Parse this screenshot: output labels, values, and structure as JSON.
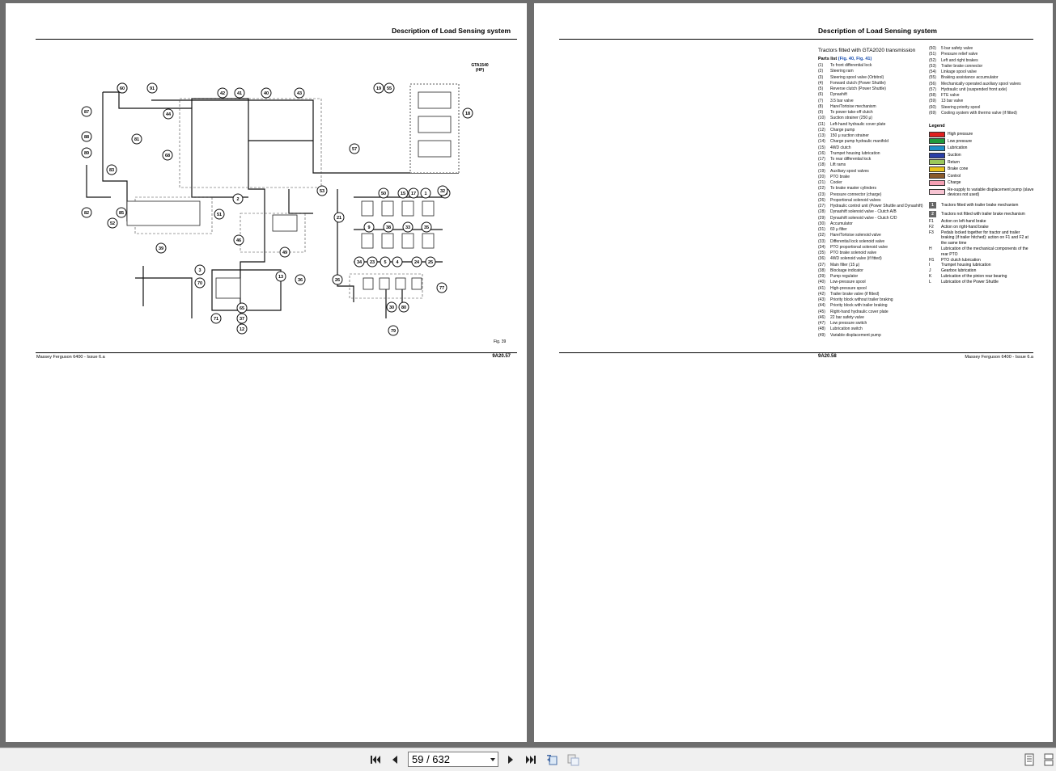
{
  "left_page": {
    "header": "Description of Load Sensing system",
    "footer_left": "Massey Ferguson 6400 - Issue 6.a",
    "footer_right": "9A20.57",
    "diagram_label": "GTA1540\n(HP)",
    "figure": "Fig. 39",
    "callouts": [
      "92",
      "91",
      "42",
      "41",
      "40",
      "43",
      "19",
      "55",
      "18",
      "87",
      "88",
      "89",
      "81",
      "44",
      "68",
      "57",
      "83",
      "52",
      "82",
      "85",
      "2",
      "51",
      "53",
      "21",
      "46",
      "49",
      "39",
      "3",
      "70",
      "71",
      "65",
      "37",
      "12",
      "13",
      "36",
      "50",
      "15",
      "17",
      "1",
      "20",
      "9",
      "38",
      "33",
      "35",
      "34",
      "23",
      "5",
      "4",
      "24",
      "25",
      "26",
      "30",
      "80",
      "77",
      "79",
      "32",
      "60"
    ]
  },
  "right_page": {
    "header": "Description of Load Sensing system",
    "footer_left": "9A20.58",
    "footer_right": "Massey Ferguson 6400 - Issue 6.a",
    "title": "Tractors fitted with GTA2020 transmission",
    "parts_list_label": "Parts list",
    "parts_list_ref": "(Fig. 40, Fig. 41)",
    "parts_col1": [
      [
        "(1)",
        "To front differential lock"
      ],
      [
        "(2)",
        "Steering ram"
      ],
      [
        "(3)",
        "Steering spool valve (Orbitrol)"
      ],
      [
        "(4)",
        "Forward clutch (Power Shuttle)"
      ],
      [
        "(5)",
        "Reverse clutch (Power Shuttle)"
      ],
      [
        "(6)",
        "Dynashift"
      ],
      [
        "(7)",
        "3.5 bar valve"
      ],
      [
        "(8)",
        "Hare/Tortoise mechanism"
      ],
      [
        "(9)",
        "To power take-off clutch"
      ],
      [
        "(10)",
        "Suction strainer (250 μ)"
      ],
      [
        "(11)",
        "Left-hand hydraulic cover plate"
      ],
      [
        "(12)",
        "Charge pump"
      ],
      [
        "(13)",
        "150 μ suction strainer"
      ],
      [
        "(14)",
        "Charge pump hydraulic manifold"
      ],
      [
        "(15)",
        "4WD clutch"
      ],
      [
        "(16)",
        "Trumpet housing lubrication"
      ],
      [
        "(17)",
        "To rear differential lock"
      ],
      [
        "(18)",
        "Lift rams"
      ],
      [
        "(19)",
        "Auxiliary spool valves"
      ],
      [
        "(20)",
        "PTO brake"
      ],
      [
        "(21)",
        "Cooler"
      ],
      [
        "(22)",
        "To brake master cylinders"
      ],
      [
        "(23)",
        "Pressure connector (charge)"
      ],
      [
        "(26)",
        "Proportional solenoid valves"
      ],
      [
        "(27)",
        "Hydraulic control unit (Power Shuttle and Dynashift)"
      ],
      [
        "(28)",
        "Dynashift solenoid valve - Clutch A/B"
      ],
      [
        "(29)",
        "Dynashift solenoid valve - Clutch C/D"
      ],
      [
        "(30)",
        "Accumulator"
      ],
      [
        "(31)",
        "60 μ filter"
      ],
      [
        "(32)",
        "Hare/Tortoise solenoid valve"
      ],
      [
        "(33)",
        "Differential lock solenoid valve"
      ],
      [
        "(34)",
        "PTO proportional solenoid valve"
      ],
      [
        "(35)",
        "PTO brake solenoid valve"
      ],
      [
        "(36)",
        "4WD solenoid valve (if fitted)"
      ],
      [
        "(37)",
        "Main filter (15 μ)"
      ],
      [
        "(38)",
        "Blockage indicator"
      ],
      [
        "(39)",
        "Pump regulator"
      ],
      [
        "(40)",
        "Low-pressure spool"
      ],
      [
        "(41)",
        "High-pressure spool"
      ],
      [
        "(42)",
        "Trailer brake valve (if fitted)"
      ],
      [
        "(43)",
        "Priority block without trailer braking"
      ],
      [
        "(44)",
        "Priority block with trailer braking"
      ],
      [
        "(45)",
        "Right-hand hydraulic cover plate"
      ],
      [
        "(46)",
        "22 bar safety valve"
      ],
      [
        "(47)",
        "Low pressure switch"
      ],
      [
        "(48)",
        "Lubrication switch"
      ],
      [
        "(49)",
        "Variable displacement pump"
      ]
    ],
    "parts_col2": [
      [
        "(50)",
        "5 bar safety valve"
      ],
      [
        "(51)",
        "Pressure relief valve"
      ],
      [
        "(52)",
        "Left and right brakes"
      ],
      [
        "(53)",
        "Trailer brake connector"
      ],
      [
        "(54)",
        "Linkage spool valve"
      ],
      [
        "(55)",
        "Braking assistance accumulator"
      ],
      [
        "(56)",
        "Mechanically operated auxiliary spool valves"
      ],
      [
        "(57)",
        "Hydraulic unit (suspended front axle)"
      ],
      [
        "(58)",
        "FTE valve"
      ],
      [
        "(59)",
        "13 bar valve"
      ],
      [
        "(60)",
        "Steering priority spool"
      ],
      [
        "(69)",
        "Cooling system with thermo valve (if fitted)"
      ]
    ],
    "legend_title": "Legend",
    "legend": [
      {
        "label": "High pressure",
        "color": "#e02020"
      },
      {
        "label": "Low pressure",
        "color": "#1f9a3c"
      },
      {
        "label": "Lubrication",
        "color": "#1f8fc8"
      },
      {
        "label": "Suction",
        "color": "#2a3fa8"
      },
      {
        "label": "Return",
        "color": "#9bc85a"
      },
      {
        "label": "Brake cone",
        "color": "#e8c21a"
      },
      {
        "label": "Control",
        "color": "#8a5a2b"
      },
      {
        "label": "Charge",
        "color": "#f4a0b4"
      },
      {
        "label": "Re-supply to variable displacement pump (slave devices not used)",
        "color": "#f7c4d2"
      }
    ],
    "tags": [
      {
        "tag": "1",
        "label": "Tractors fitted with trailer brake mechanism"
      },
      {
        "tag": "2",
        "label": "Tractors not fitted with trailer brake mechanism"
      }
    ],
    "notes": [
      [
        "F1",
        "Action on left-hand brake"
      ],
      [
        "F2",
        "Action on right-hand brake"
      ],
      [
        "F3",
        "Pedals locked together for tractor and trailer braking (if trailer hitched): action on F1 and F2 at the same time"
      ],
      [
        "H",
        "Lubrication of the mechanical components of the rear PTO"
      ],
      [
        "H1",
        "PTO clutch lubrication"
      ],
      [
        "I",
        "Trumpet housing lubrication"
      ],
      [
        "J",
        "Gearbox lubrication"
      ],
      [
        "K",
        "Lubrication of the pinion rear bearing"
      ],
      [
        "L",
        "Lubrication of the Power Shuttle"
      ]
    ]
  },
  "toolbar": {
    "page_indicator": "59 / 632",
    "icons": [
      "first-page-icon",
      "prev-page-icon",
      "next-page-icon",
      "last-page-icon",
      "rotate-back-icon",
      "rotate-forward-icon",
      "single-page-view-icon",
      "continuous-view-icon"
    ]
  }
}
